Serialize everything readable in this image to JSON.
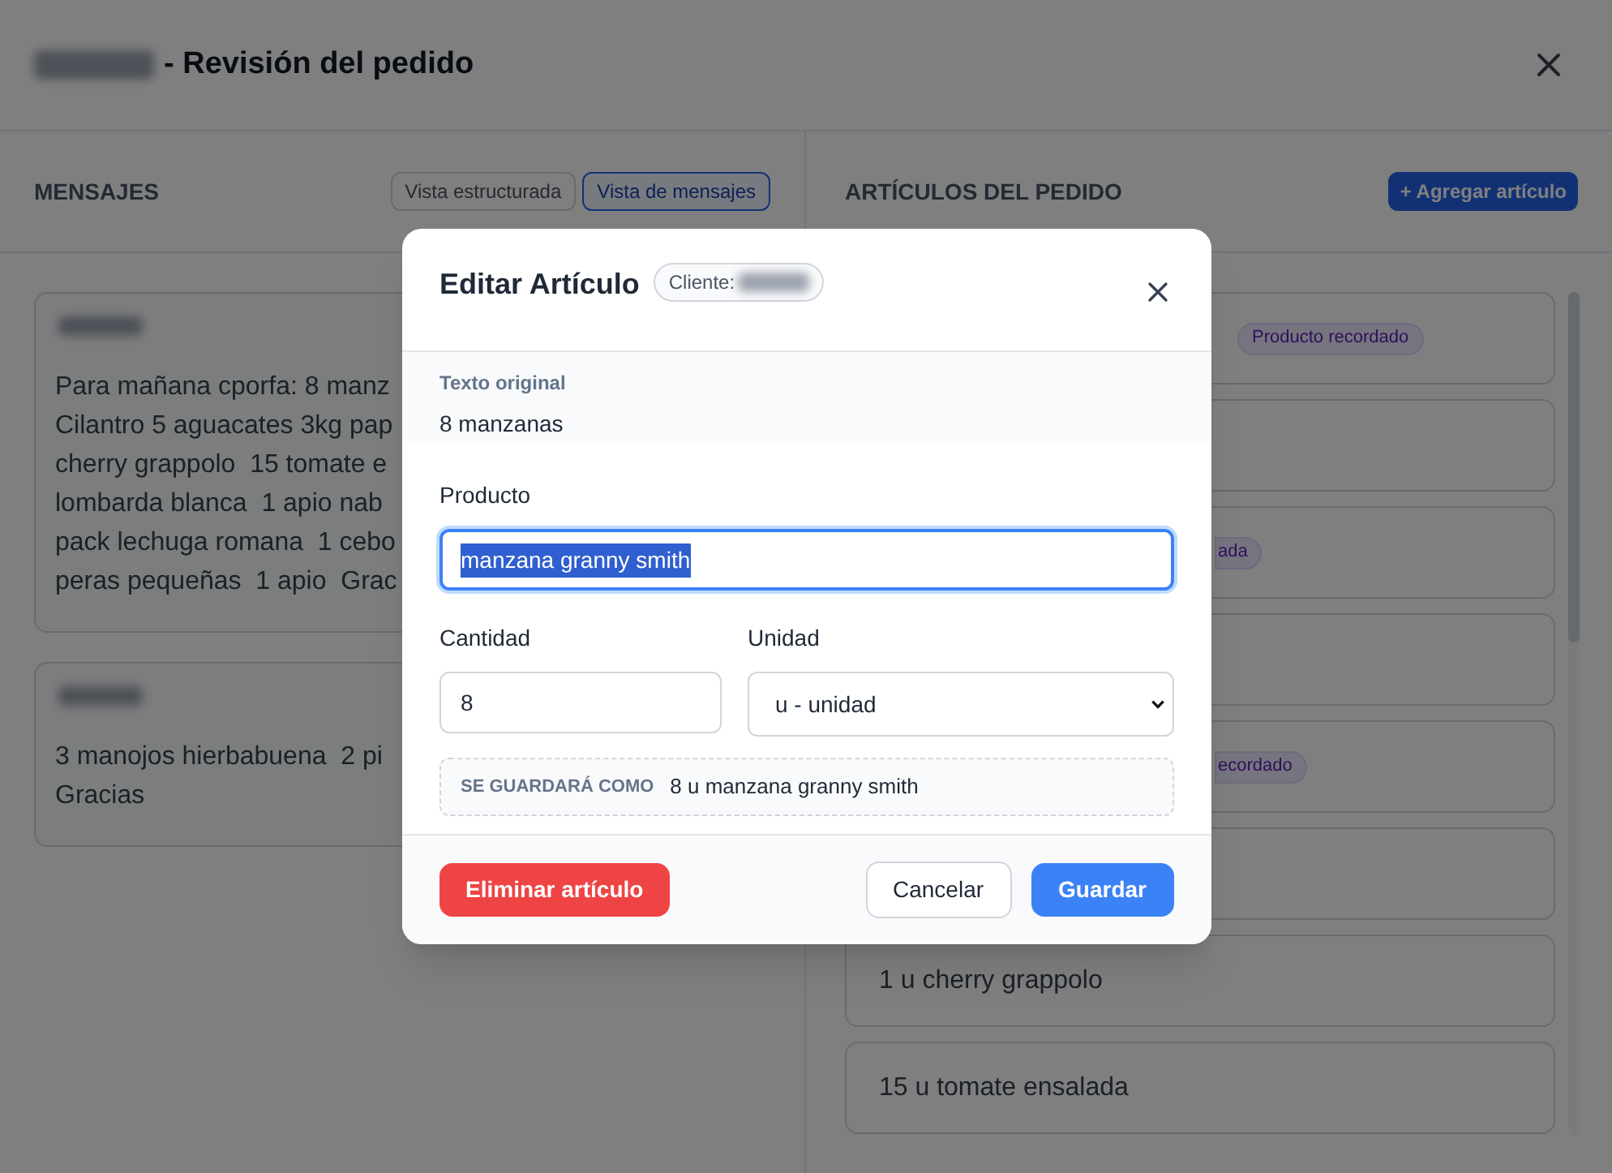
{
  "page": {
    "title": "- Revisión del pedido"
  },
  "messages_panel": {
    "heading": "MENSAJES",
    "view_toggle": [
      {
        "label": "Vista estructurada",
        "selected": false
      },
      {
        "label": "Vista de mensajes",
        "selected": true
      }
    ],
    "messages": [
      {
        "lines": [
          "Para mañana cporfa: 8 manz",
          "Cilantro 5 aguacates 3kg pap",
          "cherry grappolo  15 tomate e",
          "lombarda blanca  1 apio nab",
          "pack lechuga romana  1 cebo",
          "peras pequeñas  1 apio  Grac"
        ]
      },
      {
        "lines": [
          "3 manojos hierbabuena  2 pi",
          "Gracias"
        ]
      }
    ]
  },
  "items_panel": {
    "heading": "ARTÍCULOS DEL PEDIDO",
    "add_button": "+ Agregar artículo",
    "items": [
      {
        "kind": "badge",
        "badge": "Producto recordado",
        "cut": false
      },
      {
        "kind": "empty"
      },
      {
        "kind": "badge",
        "badge": "ada",
        "cut": true
      },
      {
        "kind": "empty"
      },
      {
        "kind": "badge",
        "badge": "ecordado",
        "cut": true
      },
      {
        "kind": "empty"
      },
      {
        "kind": "text",
        "text": "1 u cherry grappolo"
      },
      {
        "kind": "text",
        "text": "15 u tomate ensalada"
      }
    ]
  },
  "dialog": {
    "title": "Editar Artículo",
    "client_label": "Cliente:",
    "original": {
      "label": "Texto original",
      "text": "8 manzanas"
    },
    "product": {
      "label": "Producto",
      "value": "manzana granny smith",
      "value_selected": true
    },
    "quantity": {
      "label": "Cantidad",
      "value": "8"
    },
    "unit": {
      "label": "Unidad",
      "value": "u - unidad"
    },
    "preview": {
      "label": "SE GUARDARÁ COMO",
      "text": "8 u manzana granny smith"
    },
    "buttons": [
      {
        "kind": "danger",
        "label": "Eliminar artículo"
      },
      {
        "kind": "secondary",
        "label": "Cancelar"
      },
      {
        "kind": "primary",
        "label": "Guardar"
      }
    ]
  }
}
